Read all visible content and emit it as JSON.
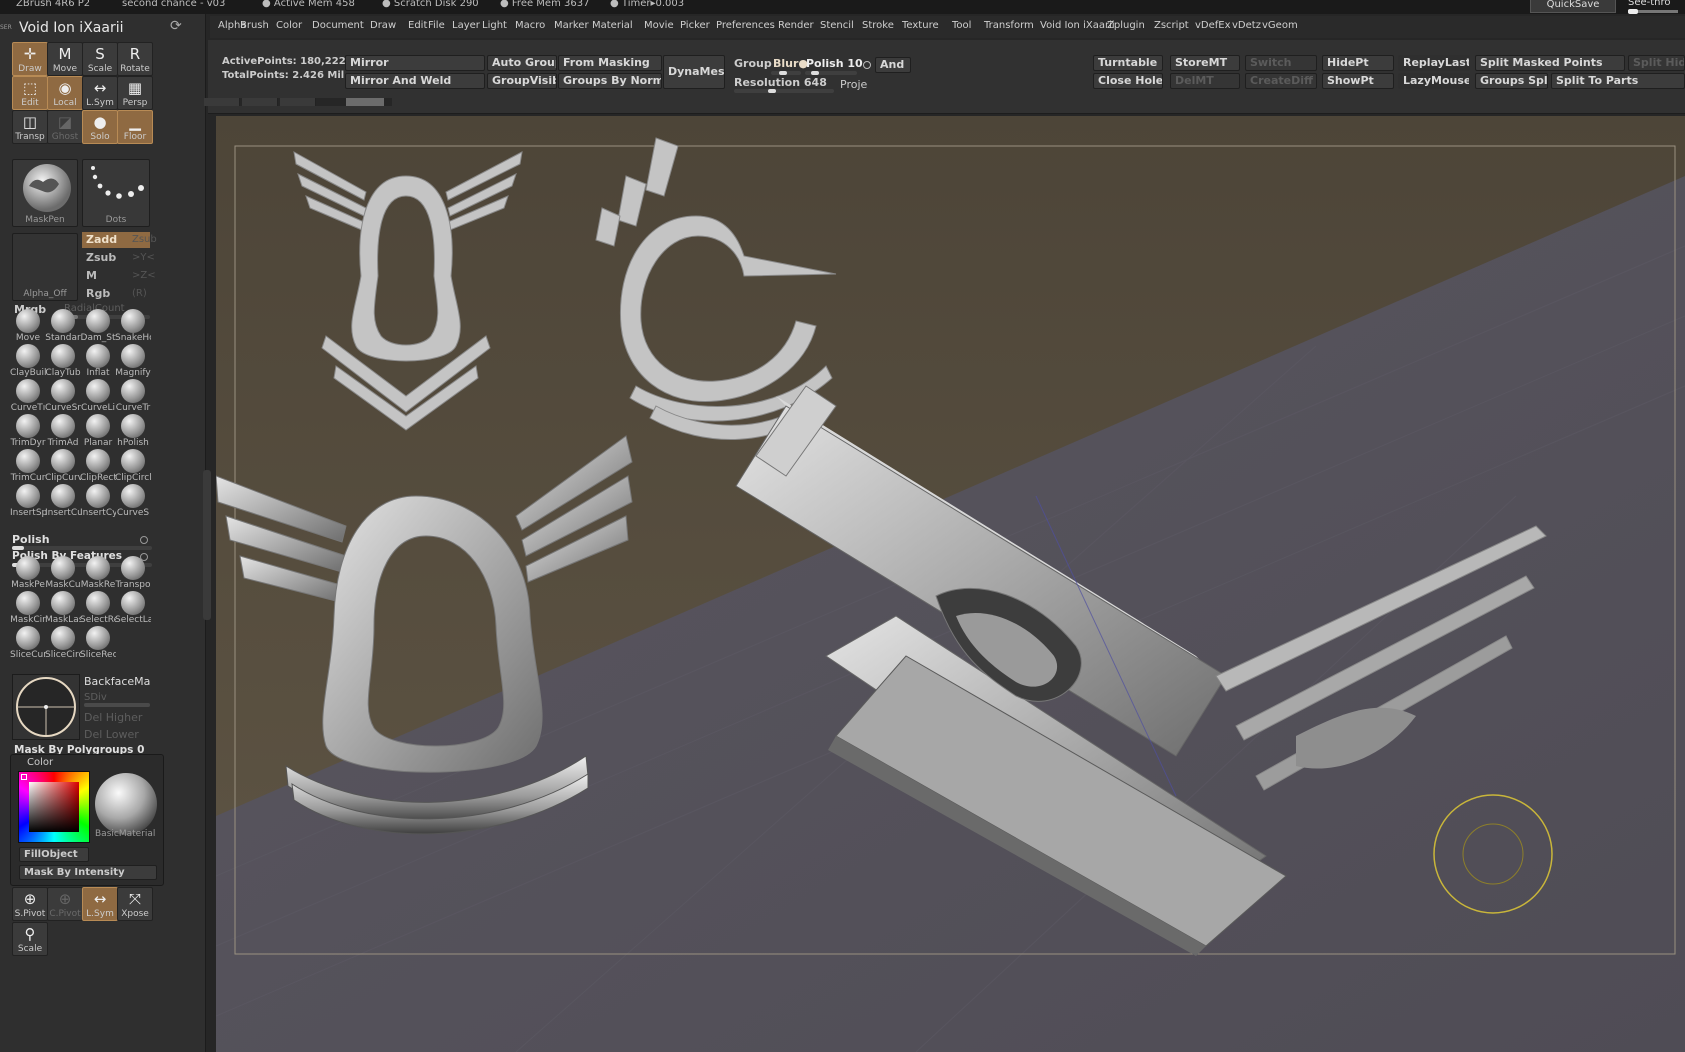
{
  "titlebar": {
    "app": "ZBrush 4R6 P2",
    "doc": "second chance - v03",
    "active_mem": "● Active Mem 458",
    "scratch": "● Scratch Disk 290",
    "free_mem": "● Free Mem 3637",
    "timer": "● Timer▸0.003",
    "quicksave": "QuickSave",
    "seethrough": "See-thro"
  },
  "menubar": [
    "Alpha",
    "Brush",
    "Color",
    "Document",
    "Draw",
    "Edit",
    "File",
    "Layer",
    "Light",
    "Macro",
    "Marker",
    "Material",
    "Movie",
    "Picker",
    "Preferences",
    "Render",
    "Stencil",
    "Stroke",
    "Texture",
    "Tool",
    "Transform",
    "Void Ion iXaarii",
    "Zplugin",
    "Zscript",
    "vDefEx",
    "vDetz",
    "vGeom"
  ],
  "left_panel": {
    "header_icon": "SER",
    "title": "Void Ion iXaarii",
    "tools": [
      {
        "label": "Draw",
        "icon": "draw-icon",
        "glyph": "✛",
        "on": true
      },
      {
        "label": "Move",
        "icon": "move-icon",
        "glyph": "M",
        "on": false
      },
      {
        "label": "Scale",
        "icon": "scale-icon",
        "glyph": "S",
        "on": false
      },
      {
        "label": "Rotate",
        "icon": "rotate-icon",
        "glyph": "R",
        "on": false
      },
      {
        "label": "Edit",
        "icon": "edit-icon",
        "glyph": "⬚",
        "on": true
      },
      {
        "label": "Local",
        "icon": "local-icon",
        "glyph": "◉",
        "on": true
      },
      {
        "label": "L.Sym",
        "icon": "lsym-icon",
        "glyph": "↔",
        "on": false
      },
      {
        "label": "Persp",
        "icon": "persp-icon",
        "glyph": "▦",
        "on": false
      },
      {
        "label": "Transp",
        "icon": "transp-icon",
        "glyph": "◫",
        "on": false
      },
      {
        "label": "Ghost",
        "icon": "ghost-icon",
        "glyph": "◪",
        "on": false,
        "dim": true
      },
      {
        "label": "Solo",
        "icon": "solo-icon",
        "glyph": "●",
        "on": true
      },
      {
        "label": "Floor",
        "icon": "floor-icon",
        "glyph": "▁",
        "on": true
      }
    ],
    "brush_thumb_label": "MaskPen",
    "stroke_thumb_label": "Dots",
    "alpha_thumb_label": "Alpha_Off",
    "modes": [
      {
        "label": "Zadd",
        "side": "Zsub",
        "on": true
      },
      {
        "label": "Zsub",
        "side": ">Y<",
        "on": false
      },
      {
        "label": "M",
        "side": ">Z<",
        "on": false
      },
      {
        "label": "Rgb",
        "side": "(R)",
        "on": false
      }
    ],
    "mrgb": "Mrgb",
    "radialcount": "RadialCount",
    "brushes": [
      {
        "label": "Move",
        "icon": "move-brush-icon"
      },
      {
        "label": "Standar",
        "icon": "standard-brush-icon"
      },
      {
        "label": "Dam_St",
        "icon": "damstandard-brush-icon"
      },
      {
        "label": "SnakeHc",
        "icon": "snakehook-brush-icon"
      },
      {
        "label": "ClayBuil",
        "icon": "claybuildup-brush-icon"
      },
      {
        "label": "ClayTub",
        "icon": "claytubes-brush-icon"
      },
      {
        "label": "Inflat",
        "icon": "inflate-brush-icon"
      },
      {
        "label": "Magnify",
        "icon": "magnify-brush-icon"
      },
      {
        "label": "CurveTı",
        "icon": "curvetube-brush-icon"
      },
      {
        "label": "CurveSr",
        "icon": "curvesurface-brush-icon"
      },
      {
        "label": "CurveLi",
        "icon": "curveline-brush-icon"
      },
      {
        "label": "CurveTr",
        "icon": "curvetriangle-brush-icon"
      },
      {
        "label": "TrimDyr",
        "icon": "trimdynamic-brush-icon"
      },
      {
        "label": "TrimAd",
        "icon": "trimadaptive-brush-icon"
      },
      {
        "label": "Planar",
        "icon": "planar-brush-icon"
      },
      {
        "label": "hPolish",
        "icon": "hpolish-brush-icon"
      },
      {
        "label": "TrimCur",
        "icon": "trimcurve-brush-icon"
      },
      {
        "label": "ClipCurv",
        "icon": "clipcurve-brush-icon"
      },
      {
        "label": "ClipRect",
        "icon": "cliprect-brush-icon"
      },
      {
        "label": "ClipCircl",
        "icon": "clipcircle-brush-icon"
      },
      {
        "label": "InsertSp",
        "icon": "insertsphere-brush-icon"
      },
      {
        "label": "InsertCu",
        "icon": "insertcube-brush-icon"
      },
      {
        "label": "InsertCy",
        "icon": "insertcylinder-brush-icon"
      },
      {
        "label": "CurveS",
        "icon": "curvestrap-brush-icon"
      }
    ],
    "polish_label": "Polish",
    "polish_by_features": "Polish By Features",
    "mask_brushes": [
      {
        "label": "MaskPe",
        "icon": "maskpen-brush-icon"
      },
      {
        "label": "MaskCu",
        "icon": "maskcurve-brush-icon"
      },
      {
        "label": "MaskRe",
        "icon": "maskrect-brush-icon"
      },
      {
        "label": "Transpo",
        "icon": "transpose-brush-icon"
      },
      {
        "label": "MaskCir",
        "icon": "maskcircle-brush-icon"
      },
      {
        "label": "MaskLas",
        "icon": "masklasso-brush-icon"
      },
      {
        "label": "SelectRe",
        "icon": "selectrect-brush-icon"
      },
      {
        "label": "SelectLa",
        "icon": "selectlasso-brush-icon"
      },
      {
        "label": "SliceCur",
        "icon": "slicecurve-brush-icon"
      },
      {
        "label": "SliceCirc",
        "icon": "slicecircle-brush-icon"
      },
      {
        "label": "SliceRec",
        "icon": "slicerect-brush-icon"
      }
    ],
    "backface": "BackfaceMa",
    "sdiv": "SDiv",
    "del_higher": "Del Higher",
    "del_lower": "Del Lower",
    "mask_by_polygroups": "Mask By Polygroups 0",
    "color_title": "Color",
    "material_label": "BasicMaterial",
    "fill_object": "FillObject",
    "mask_by_intensity": "Mask By Intensity",
    "bottom_tools": [
      {
        "label": "S.Pivot",
        "icon": "spivot-icon",
        "glyph": "⊕",
        "on": false
      },
      {
        "label": "C.Pivot",
        "icon": "cpivot-icon",
        "glyph": "⊕",
        "on": false,
        "dim": true
      },
      {
        "label": "L.Sym",
        "icon": "lsym-bottom-icon",
        "glyph": "↔",
        "on": true
      },
      {
        "label": "Xpose",
        "icon": "xpose-icon",
        "glyph": "⤧",
        "on": false
      },
      {
        "label": "Scale",
        "icon": "scale-bottom-icon",
        "glyph": "⚲",
        "on": false
      }
    ]
  },
  "topbar": {
    "active_points": "ActivePoints: 180,222",
    "total_points": "TotalPoints: 2.426 Mil",
    "mirror": "Mirror",
    "mirror_weld": "Mirror And Weld",
    "auto_groups": "Auto Groups",
    "group_visible": "GroupVisible",
    "from_masking": "From Masking",
    "groups_by_normal": "Groups By Normals",
    "dynamesh": "DynaMesh",
    "group": "Group",
    "blur": "Blur●",
    "polish": "Polish 10",
    "and": "And",
    "resolution": "Resolution 648",
    "project": "Proje",
    "turntable": "Turntable",
    "storemt": "StoreMT",
    "switch": "Switch",
    "hidept": "HidePt",
    "replaylast": "ReplayLast",
    "split_masked": "Split Masked Points",
    "split_hidden": "Split Hidde",
    "close_holes": "Close Holes",
    "delmt": "DelMT",
    "creatediff": "CreateDiff",
    "showpt": "ShowPt",
    "lazymouse": "LazyMouse",
    "groups_split": "Groups Split",
    "split_to_parts": "Split To Parts"
  },
  "colors": {
    "accent": "#8f6a42",
    "panel": "#2f2f2f",
    "canvas_top": "#5e5445",
    "canvas_floor": "#5c5863",
    "mesh": "#b9b9b9",
    "gizmo": "#c9b63a"
  }
}
